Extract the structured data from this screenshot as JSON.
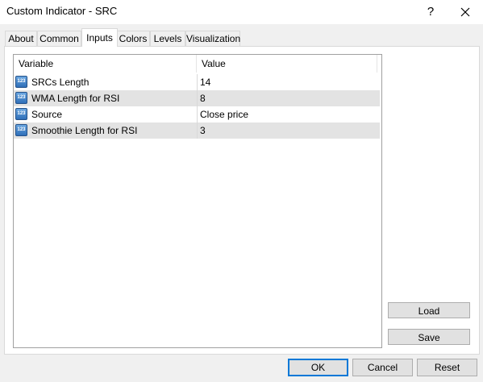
{
  "window": {
    "title": "Custom Indicator - SRC",
    "help_label": "?"
  },
  "tabs": [
    {
      "label": "About"
    },
    {
      "label": "Common"
    },
    {
      "label": "Inputs"
    },
    {
      "label": "Colors"
    },
    {
      "label": "Levels"
    },
    {
      "label": "Visualization"
    }
  ],
  "active_tab": "Inputs",
  "grid": {
    "columns": {
      "variable": "Variable",
      "value": "Value"
    },
    "rows": [
      {
        "icon": "123",
        "variable": "SRCs Length",
        "value": "14"
      },
      {
        "icon": "123",
        "variable": "WMA Length for RSI",
        "value": "8"
      },
      {
        "icon": "123",
        "variable": "Source",
        "value": "Close price"
      },
      {
        "icon": "123",
        "variable": "Smoothie Length for RSI",
        "value": "3"
      }
    ]
  },
  "side_buttons": {
    "load": "Load",
    "save": "Save"
  },
  "buttons": {
    "ok": "OK",
    "cancel": "Cancel",
    "reset": "Reset"
  },
  "colors": {
    "accent": "#0078d7",
    "row_alt": "#e3e3e3",
    "icon_blue": "#2f6fb8"
  }
}
